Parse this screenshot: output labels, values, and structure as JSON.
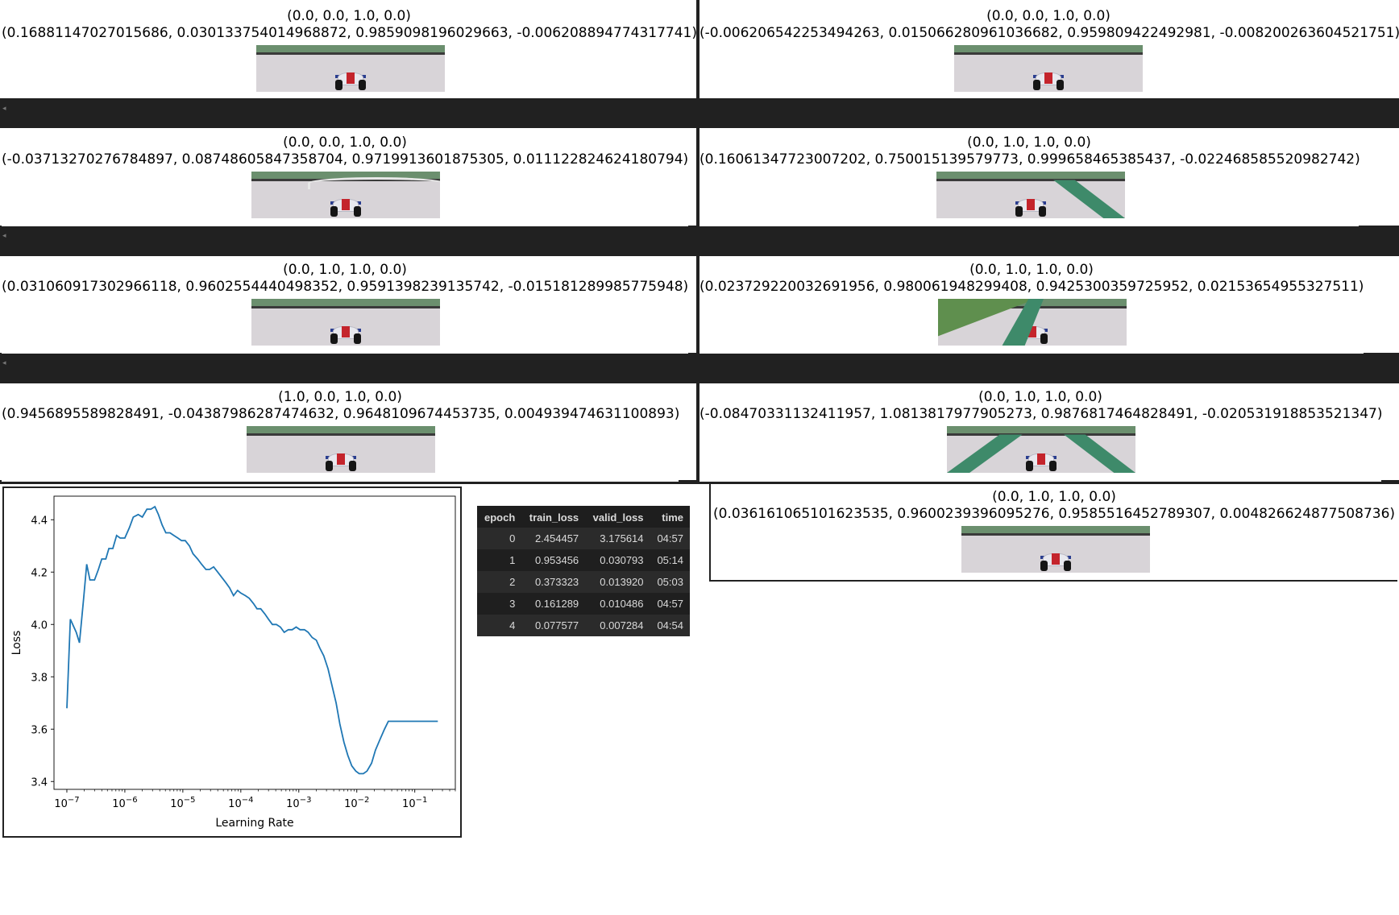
{
  "cells": [
    {
      "action": "(0.0, 0.0, 1.0, 0.0)",
      "prediction": "(0.16881147027015686, 0.030133754014968872, 0.9859098196029663, -0.006208894774317741)",
      "scene": "straight"
    },
    {
      "action": "(0.0, 0.0, 1.0, 0.0)",
      "prediction": "(-0.006206542253494263, 0.015066280961036682, 0.959809422492981, -0.008200263604521751)",
      "scene": "straight-narrow"
    },
    {
      "action": "(0.0, 0.0, 1.0, 0.0)",
      "prediction": "(-0.03713270276784897, 0.08748605847358704, 0.9719913601875305, 0.011122824624180794)",
      "scene": "curve"
    },
    {
      "action": "(0.0, 1.0, 1.0, 0.0)",
      "prediction": "(0.16061347723007202, 0.750015139579773, 0.999658465385437, -0.022468585520982742)",
      "scene": "kerb-right"
    },
    {
      "action": "(0.0, 1.0, 1.0, 0.0)",
      "prediction": "(0.031060917302966118, 0.9602554440498352, 0.9591398239135742, -0.015181289985775948)",
      "scene": "straight"
    },
    {
      "action": "(0.0, 1.0, 1.0, 0.0)",
      "prediction": "(0.023729220032691956, 0.980061948299408, 0.9425300359725952, 0.02153654955327511)",
      "scene": "grass-left"
    },
    {
      "action": "(1.0, 0.0, 1.0, 0.0)",
      "prediction": "(0.9456895589828491, -0.04387986287474632, 0.9648109674453735, 0.004939474631100893)",
      "scene": "straight"
    },
    {
      "action": "(0.0, 1.0, 1.0, 0.0)",
      "prediction": "(-0.08470331132411957, 1.0813817977905273, 0.9876817464828491, -0.020531918853521347)",
      "scene": "kerb-both"
    },
    {
      "action": "(0.0, 1.0, 1.0, 0.0)",
      "prediction": "(0.036161065101623535, 0.9600239396095276, 0.9585516452789307, 0.004826624877508736)",
      "scene": "straight"
    }
  ],
  "band_marker": "◂",
  "table": {
    "columns": [
      "epoch",
      "train_loss",
      "valid_loss",
      "time"
    ],
    "rows": [
      [
        "0",
        "2.454457",
        "3.175614",
        "04:57"
      ],
      [
        "1",
        "0.953456",
        "0.030793",
        "05:14"
      ],
      [
        "2",
        "0.373323",
        "0.013920",
        "05:03"
      ],
      [
        "3",
        "0.161289",
        "0.010486",
        "04:57"
      ],
      [
        "4",
        "0.077577",
        "0.007284",
        "04:54"
      ]
    ]
  },
  "colors": {
    "line": "#1f77b4",
    "band": "#212121",
    "table_bg": "#1e1e1e"
  },
  "chart_data": {
    "type": "line",
    "xlabel": "Learning Rate",
    "ylabel": "Loss",
    "xscale": "log",
    "xlim": [
      6e-08,
      0.5
    ],
    "ylim": [
      3.37,
      4.49
    ],
    "yticks": [
      "3.4",
      "3.6",
      "3.8",
      "4.0",
      "4.2",
      "4.4"
    ],
    "yticks_values": [
      3.4,
      3.6,
      3.8,
      4.0,
      4.2,
      4.4
    ],
    "xticks_exponents": [
      -7,
      -6,
      -5,
      -4,
      -3,
      -2,
      -1
    ],
    "grid": false,
    "series": [
      {
        "x": [
          1e-07,
          1.15e-07,
          1.45e-07,
          1.65e-07,
          1.95e-07,
          2.2e-07,
          2.5e-07,
          3e-07,
          3.5e-07,
          4e-07,
          4.7e-07,
          5.3e-07,
          6.2e-07,
          7.2e-07,
          8.3e-07,
          1e-06,
          1.2e-06,
          1.4e-06,
          1.7e-06,
          2e-06,
          2.4e-06,
          2.8e-06,
          3.3e-06,
          3.8e-06,
          4.4e-06,
          5.1e-06,
          6e-06,
          7e-06,
          8.2e-06,
          9.5e-06,
          1.1e-05,
          1.3e-05,
          1.5e-05,
          1.8e-05,
          2.1e-05,
          2.5e-05,
          2.9e-05,
          3.4e-05,
          4e-05,
          4.7e-05,
          5.5e-05,
          6.4e-05,
          7.5e-05,
          8.8e-05,
          0.0001,
          0.00012,
          0.00014,
          0.000165,
          0.00019,
          0.00022,
          0.00026,
          0.0003,
          0.00035,
          0.00041,
          0.00048,
          0.00056,
          0.00066,
          0.00077,
          0.0009,
          0.00105,
          0.00125,
          0.00145,
          0.0017,
          0.002,
          0.0023,
          0.0027,
          0.0032,
          0.0037,
          0.0044,
          0.0051,
          0.006,
          0.007,
          0.0082,
          0.0096,
          0.011,
          0.013,
          0.015,
          0.018,
          0.021,
          0.025,
          0.03,
          0.035,
          0.041,
          0.048,
          0.056,
          0.065,
          0.076,
          0.089,
          0.104,
          0.121,
          0.142,
          0.165,
          0.19,
          0.22,
          0.25
        ],
        "y": [
          3.68,
          4.02,
          3.97,
          3.93,
          4.1,
          4.23,
          4.17,
          4.17,
          4.21,
          4.25,
          4.25,
          4.29,
          4.29,
          4.34,
          4.33,
          4.33,
          4.37,
          4.41,
          4.42,
          4.41,
          4.44,
          4.44,
          4.45,
          4.42,
          4.38,
          4.35,
          4.35,
          4.34,
          4.33,
          4.32,
          4.32,
          4.3,
          4.27,
          4.25,
          4.23,
          4.21,
          4.21,
          4.22,
          4.2,
          4.18,
          4.16,
          4.14,
          4.11,
          4.13,
          4.12,
          4.11,
          4.1,
          4.08,
          4.06,
          4.06,
          4.04,
          4.02,
          4.0,
          4.0,
          3.99,
          3.97,
          3.98,
          3.98,
          3.99,
          3.98,
          3.98,
          3.97,
          3.95,
          3.94,
          3.91,
          3.88,
          3.83,
          3.77,
          3.7,
          3.62,
          3.55,
          3.5,
          3.46,
          3.44,
          3.43,
          3.43,
          3.44,
          3.47,
          3.52,
          3.56,
          3.6,
          3.63,
          3.63,
          3.63,
          3.63,
          3.63,
          3.63,
          3.63,
          3.63,
          3.63,
          3.63,
          3.63,
          3.63,
          3.63,
          3.63
        ]
      }
    ]
  }
}
